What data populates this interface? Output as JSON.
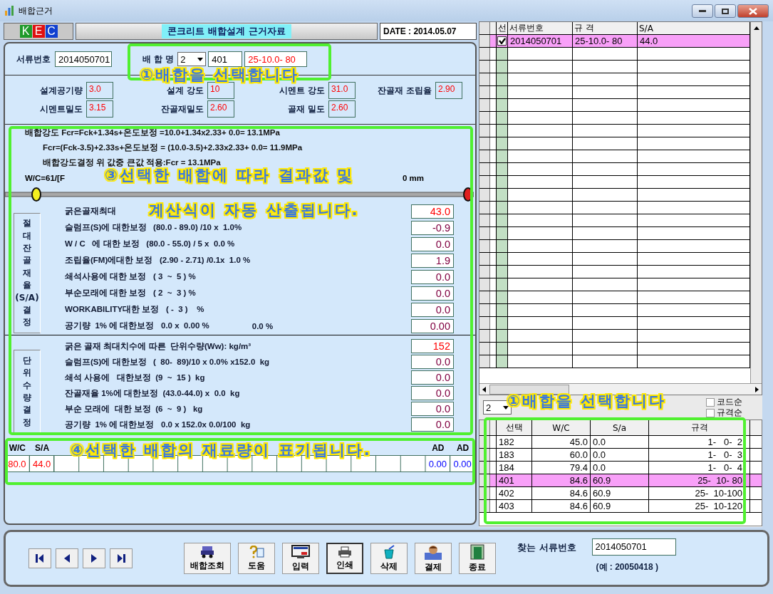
{
  "window": {
    "title": "배합근거"
  },
  "header": {
    "logo": [
      {
        "letter": "K",
        "color": "#1f9a2a"
      },
      {
        "letter": "E",
        "color": "#e01010"
      },
      {
        "letter": "C",
        "color": "#1040d0"
      }
    ],
    "title": "콘크리트 배합설계 근거자료",
    "date": "DATE : 2014.05.07"
  },
  "mix_selector": {
    "doc_label": "서류번호",
    "doc_no": "2014050701",
    "mix_label": "배 합 명",
    "combo": "2",
    "code": "401",
    "spec": "25-10.0- 80",
    "callout": {
      "number": "①",
      "lines": [
        "배합을 선택합니다"
      ]
    }
  },
  "properties": [
    {
      "label": "설계공기량",
      "value": "3.0"
    },
    {
      "label": "설계 강도",
      "value": "10"
    },
    {
      "label": "시멘트 강도",
      "value": "31.0"
    },
    {
      "label": "잔골재 조립율",
      "value": "2.90"
    },
    {
      "label": "시멘트밀도",
      "value": "3.15"
    },
    {
      "label": "잔골재밀도",
      "value": "2.60"
    },
    {
      "label": "골재 밀도",
      "value": "2.60"
    }
  ],
  "formulas": {
    "lines": [
      "배합강도 Fcr=Fck+1.34s+온도보정 =10.0+1.34x2.33+ 0.0= 13.1MPa",
      "Fcr=(Fck-3.5)+2.33s+온도보정 = (10.0-3.5)+2.33x2.33+ 0.0= 11.9MPa",
      "배합강도결정 위 값중 큰값 적용:Fcr = 13.1MPa"
    ],
    "partial_left": "W/C=61/[F",
    "partial_right": "0 mm",
    "callout": {
      "number": "③",
      "lines": [
        "선택한 배합에 따라 결과값 및",
        "계산식이 자동 산출됩니다."
      ]
    }
  },
  "sa_section": {
    "label": "절대잔골재율(S/A)결정",
    "rows": [
      {
        "text": "굵은골재최대",
        "value": "43.0",
        "color": "#ff0000"
      },
      {
        "text": "슬럼프(S)에 대한보정   (80.0 - 89.0) /10 x  1.0%",
        "value": "-0.9",
        "color": "#800040"
      },
      {
        "text": "W / C   에 대한 보정   (80.0 - 55.0) / 5 x  0.0 %",
        "value": "0.0",
        "color": "#800040"
      },
      {
        "text": "조립율(FM)에대한 보정   (2.90 - 2.71) /0.1x  1.0 %",
        "value": "1.9",
        "color": "#800040"
      },
      {
        "text": "쇄석사용에 대한 보정   ( 3  ~  5 ) %",
        "value": "0.0",
        "color": "#800040"
      },
      {
        "text": "부순모래에 대한 보정   ( 2  ~  3 ) %",
        "value": "0.0",
        "color": "#800040"
      },
      {
        "text": "WORKABILITY대한 보정   ( -  3 )    %",
        "value": "0.0",
        "color": "#800040"
      },
      {
        "text": "공기량  1% 에 대한보정   0.0 x  0.00 %",
        "extra": "0.0 %",
        "value": "0.00",
        "color": "#800040"
      }
    ]
  },
  "ww_section": {
    "label": "단위수량결정",
    "rows": [
      {
        "text": "굵은 골재 최대치수에 따른  단위수량(Ww): kg/m³",
        "value": "152",
        "color": "#ff0000"
      },
      {
        "text": "슬럼프(S)에 대한보정   (  80-  89)/10 x 0.0% x152.0  kg",
        "value": "0.0",
        "color": "#800040"
      },
      {
        "text": "쇄석 사용에   대한보정  (9  ~  15 )  kg",
        "value": "0.0",
        "color": "#800040"
      },
      {
        "text": "잔골재율 1%에 대한보정  (43.0-44.0) x  0.0  kg",
        "value": "0.0",
        "color": "#800040"
      },
      {
        "text": "부순 모래에  대한 보정  (6  ~  9 )   kg",
        "value": "0.0",
        "color": "#800040"
      },
      {
        "text": "공기량  1% 에 대한보정   0.0 x 152.0x 0.0/100  kg",
        "value": "0.0",
        "color": "#800040"
      }
    ]
  },
  "materials": {
    "columns": [
      {
        "header": "W/C",
        "value": "80.0",
        "color": "#ff0000"
      },
      {
        "header": "S/A",
        "value": "44.0",
        "color": "#ff0000"
      },
      {},
      {},
      {},
      {},
      {},
      {},
      {},
      {},
      {},
      {},
      {},
      {},
      {},
      {},
      {},
      {
        "header": "AD",
        "value": "0.00",
        "color": "#0000ff"
      },
      {
        "header": "AD",
        "value": "0.00",
        "color": "#0000ff"
      }
    ],
    "callout": {
      "number": "④",
      "lines": [
        "선택한 배합의 재료량이 표기됩니다."
      ]
    }
  },
  "doc_grid": {
    "columns": [
      "선",
      "서류번호",
      "규 격",
      "S/A"
    ],
    "rows": [
      {
        "checked": true,
        "selected": true,
        "cells": [
          "",
          "2014050701",
          "25-10.0- 80",
          "44.0"
        ]
      }
    ]
  },
  "mix_list": {
    "combo": "2",
    "sort_options": [
      {
        "label": "코드순",
        "selected": false
      },
      {
        "label": "규격순",
        "selected": false
      }
    ],
    "columns": [
      "선택",
      "W/C",
      "S/a",
      "규격"
    ],
    "rows": [
      {
        "cells": [
          "182",
          "45.0",
          "0.0",
          "1-   0-  2"
        ],
        "selected": false
      },
      {
        "cells": [
          "183",
          "60.0",
          "0.0",
          "1-   0-  3"
        ],
        "selected": false
      },
      {
        "cells": [
          "184",
          "79.4",
          "0.0",
          "1-   0-  4"
        ],
        "selected": false
      },
      {
        "cells": [
          "401",
          "84.6",
          "60.9",
          "25-  10- 80"
        ],
        "selected": true
      },
      {
        "cells": [
          "402",
          "84.6",
          "60.9",
          "25-  10-100"
        ],
        "selected": false
      },
      {
        "cells": [
          "403",
          "84.6",
          "60.9",
          "25-  10-120"
        ],
        "selected": false
      }
    ],
    "callout": {
      "number": "①",
      "lines": [
        "배합을 선택합니다"
      ]
    }
  },
  "nav_buttons": [
    {
      "kind": "first"
    },
    {
      "kind": "prev"
    },
    {
      "kind": "next"
    },
    {
      "kind": "last"
    }
  ],
  "actions": [
    {
      "kind": "query",
      "label": "배합조회",
      "focused": false
    },
    {
      "kind": "help",
      "label": "도움",
      "focused": false
    },
    {
      "kind": "input",
      "label": "입력",
      "focused": false
    },
    {
      "kind": "print",
      "label": "인쇄",
      "focused": true
    },
    {
      "kind": "delete",
      "label": "삭제",
      "focused": false
    },
    {
      "kind": "approve",
      "label": "결제",
      "focused": false
    },
    {
      "kind": "exit",
      "label": "종료",
      "focused": false
    }
  ],
  "search": {
    "label": "찾는 서류번호",
    "value": "2014050701",
    "example": "(예 : 20050418 )"
  }
}
